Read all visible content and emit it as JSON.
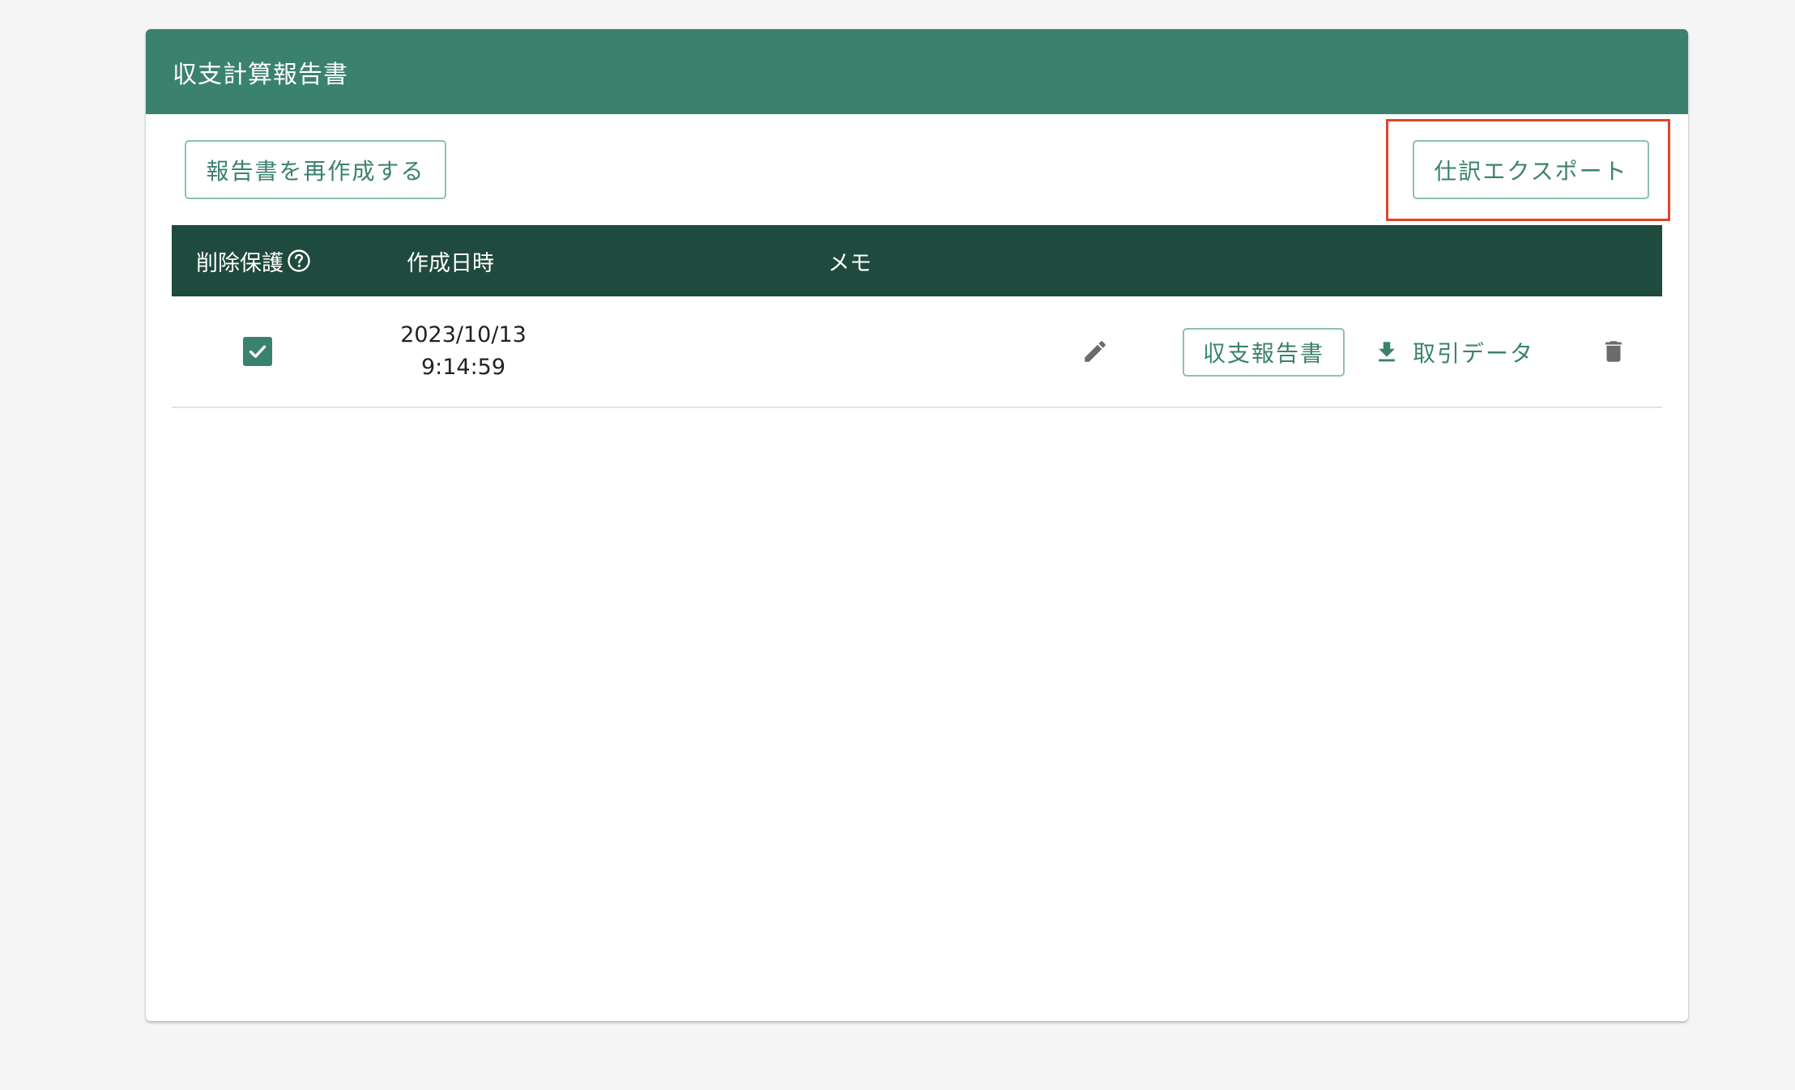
{
  "header": {
    "title": "収支計算報告書"
  },
  "toolbar": {
    "recreate_label": "報告書を再作成する",
    "export_label": "仕訳エクスポート"
  },
  "table": {
    "columns": {
      "protect": "削除保護",
      "created_at": "作成日時",
      "memo": "メモ"
    },
    "rows": [
      {
        "protected": true,
        "date": "2023/10/13",
        "time": "9:14:59",
        "memo": "",
        "report_label": "収支報告書",
        "download_label": "取引データ"
      }
    ]
  },
  "colors": {
    "header_bg": "#3a826e",
    "table_head_bg": "#1f4a3e",
    "accent": "#3a826e",
    "highlight": "#e0442c"
  },
  "icons": {
    "help": "help-circle-icon",
    "checkbox": "checkbox-checked-icon",
    "edit": "pencil-icon",
    "download": "download-icon",
    "delete": "trash-icon"
  }
}
